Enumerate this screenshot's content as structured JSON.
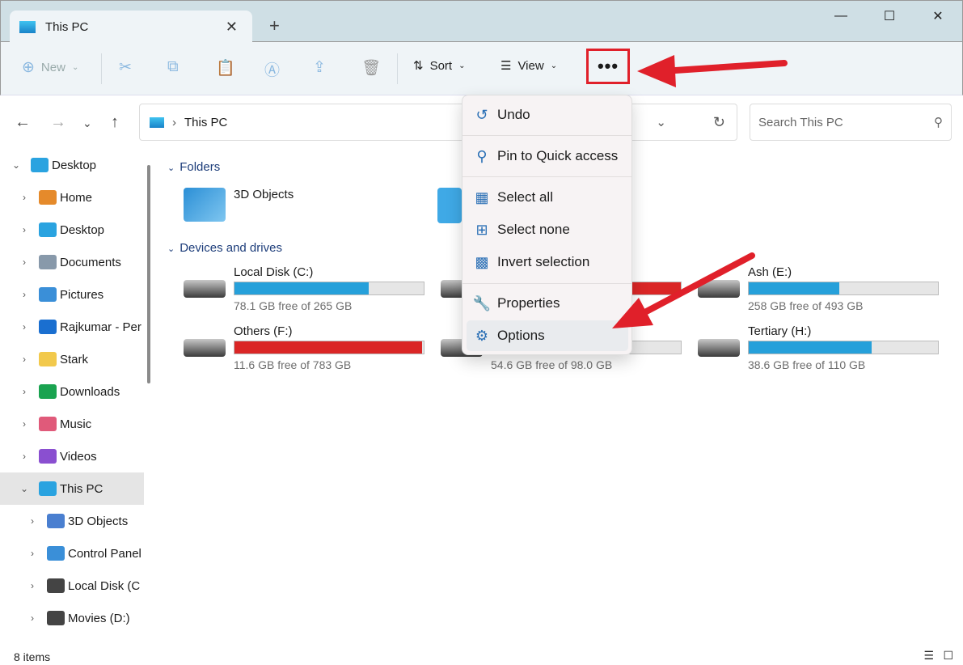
{
  "tab": {
    "title": "This PC"
  },
  "toolbar": {
    "new": "New",
    "sort": "Sort",
    "view": "View",
    "more": "•••"
  },
  "address": {
    "location": "This PC",
    "search_placeholder": "Search This PC"
  },
  "sidebar": [
    {
      "label": "Desktop",
      "level": 0,
      "expanded": true
    },
    {
      "label": "Home",
      "level": 1
    },
    {
      "label": "Desktop",
      "level": 1
    },
    {
      "label": "Documents",
      "level": 1
    },
    {
      "label": "Pictures",
      "level": 1
    },
    {
      "label": "Rajkumar - Per",
      "level": 1
    },
    {
      "label": "Stark",
      "level": 1
    },
    {
      "label": "Downloads",
      "level": 1
    },
    {
      "label": "Music",
      "level": 1
    },
    {
      "label": "Videos",
      "level": 1
    },
    {
      "label": "This PC",
      "level": 1,
      "selected": true
    },
    {
      "label": "3D Objects",
      "level": 2
    },
    {
      "label": "Control Panel",
      "level": 2
    },
    {
      "label": "Local Disk (C",
      "level": 2
    },
    {
      "label": "Movies (D:)",
      "level": 2
    }
  ],
  "sections": {
    "folders": "Folders",
    "drives": "Devices and drives"
  },
  "folders": [
    {
      "name": "3D Objects"
    }
  ],
  "drives": [
    {
      "name": "Local Disk (C:)",
      "free": "78.1 GB free of 265 GB",
      "used_pct": 71,
      "red": false
    },
    {
      "name": "",
      "free": "",
      "used_pct": 100,
      "red": true
    },
    {
      "name": "Ash (E:)",
      "free": "258 GB free of 493 GB",
      "used_pct": 48,
      "red": false
    },
    {
      "name": "Others (F:)",
      "free": "11.6 GB free of 783 GB",
      "used_pct": 99,
      "red": true
    },
    {
      "name": "",
      "free": "54.6 GB free of 98.0 GB",
      "used_pct": 44,
      "red": false
    },
    {
      "name": "Tertiary (H:)",
      "free": "38.6 GB free of 110 GB",
      "used_pct": 65,
      "red": false
    }
  ],
  "menu": [
    {
      "label": "Undo",
      "icon": "undo-icon",
      "glyph": "↺"
    },
    {
      "label": "Pin to Quick access",
      "icon": "pin-icon",
      "glyph": "⚲"
    },
    {
      "label": "Select all",
      "icon": "select-all-icon",
      "glyph": "▦"
    },
    {
      "label": "Select none",
      "icon": "select-none-icon",
      "glyph": "⊞"
    },
    {
      "label": "Invert selection",
      "icon": "invert-selection-icon",
      "glyph": "▩"
    },
    {
      "label": "Properties",
      "icon": "wrench-icon",
      "glyph": "🔧"
    },
    {
      "label": "Options",
      "icon": "gear-icon",
      "glyph": "⚙"
    }
  ],
  "status": {
    "items": "8 items"
  },
  "colors": {
    "accent": "#26a0da",
    "danger": "#da2626",
    "annotation": "#e0202a"
  }
}
